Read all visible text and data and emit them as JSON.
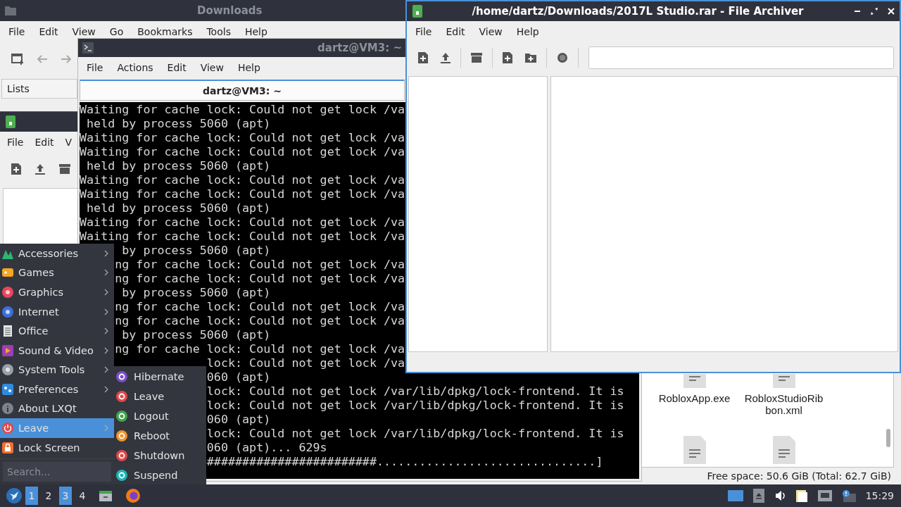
{
  "downloads_window": {
    "title": "Downloads",
    "menu": [
      "File",
      "Edit",
      "View",
      "Go",
      "Bookmarks",
      "Tools",
      "Help"
    ],
    "side_pane": [
      "Lists"
    ],
    "files": [
      {
        "name": "RobloxApp.exe",
        "kind": "top-hidden"
      },
      {
        "name": "RobloxStudioRibbon.xml",
        "kind": "top-hidden"
      },
      {
        "kind": "bottom-hidden"
      },
      {
        "kind": "bottom-hidden"
      }
    ],
    "status": "Free space: 50.6 GiB (Total: 62.7 GiB)"
  },
  "back_archive_window": {
    "menu": [
      "File",
      "Edit",
      "V"
    ]
  },
  "terminal_window": {
    "title": "dartz@VM3: ~",
    "menu": [
      "File",
      "Actions",
      "Edit",
      "View",
      "Help"
    ],
    "tab": "dartz@VM3: ~",
    "lines": [
      {
        "text": "Waiting for cache lock: Could not get lock /va",
        "kind": "full"
      },
      {
        "text": " held by process 5060 (apt)",
        "kind": "full"
      },
      {
        "text": "Waiting for cache lock: Could not get lock /va",
        "kind": "full"
      },
      {
        "text": "Waiting for cache lock: Could not get lock /va",
        "kind": "full"
      },
      {
        "text": " held by process 5060 (apt)",
        "kind": "full"
      },
      {
        "text": "Waiting for cache lock: Could not get lock /va",
        "kind": "full"
      },
      {
        "text": "Waiting for cache lock: Could not get lock /va",
        "kind": "full"
      },
      {
        "text": " held by process 5060 (apt)",
        "kind": "full"
      },
      {
        "text": "Waiting for cache lock: Could not get lock /va",
        "kind": "full"
      },
      {
        "text": "Waiting for cache lock: Could not get lock /va",
        "kind": "full"
      },
      {
        "text": " by process 5060 (apt)",
        "kind": "under-menu"
      },
      {
        "text": "ng for cache lock: Could not get lock /va",
        "kind": "under-menu"
      },
      {
        "text": "ng for cache lock: Could not get lock /va",
        "kind": "under-menu"
      },
      {
        "text": " by process 5060 (apt)",
        "kind": "under-menu"
      },
      {
        "text": "ng for cache lock: Could not get lock /va",
        "kind": "under-menu"
      },
      {
        "text": "ng for cache lock: Could not get lock /va",
        "kind": "under-menu"
      },
      {
        "text": " by process 5060 (apt)",
        "kind": "under-menu"
      },
      {
        "text": "ng for cache lock: Could not get lock /va",
        "kind": "under-menu"
      },
      {
        "text": "lock: Could not get lock /va",
        "kind": "under-submenu"
      },
      {
        "text": "060 (apt)",
        "kind": "under-submenu"
      },
      {
        "text": "lock: Could not get lock /var/lib/dpkg/lock-frontend. It is",
        "kind": "under-submenu"
      },
      {
        "text": "lock: Could not get lock /var/lib/dpkg/lock-frontend. It is",
        "kind": "under-submenu"
      },
      {
        "text": "060 (apt)",
        "kind": "under-submenu"
      },
      {
        "text": "lock: Could not get lock /var/lib/dpkg/lock-frontend. It is",
        "kind": "under-submenu"
      },
      {
        "text": "060 (apt)... 629s",
        "kind": "under-submenu"
      },
      {
        "text": "########################...............................]",
        "kind": "under-submenu"
      }
    ]
  },
  "archive_window": {
    "title": "/home/dartz/Downloads/2017L Studio.rar - File Archiver",
    "menu": [
      "File",
      "Edit",
      "View",
      "Help"
    ]
  },
  "start_menu": {
    "items": [
      {
        "label": "Accessories",
        "kind": "accessories",
        "submenu": true,
        "selected": false
      },
      {
        "label": "Games",
        "kind": "games",
        "submenu": true,
        "selected": false
      },
      {
        "label": "Graphics",
        "kind": "graphics",
        "submenu": true,
        "selected": false
      },
      {
        "label": "Internet",
        "kind": "internet",
        "submenu": true,
        "selected": false
      },
      {
        "label": "Office",
        "kind": "office",
        "submenu": true,
        "selected": false
      },
      {
        "label": "Sound & Video",
        "kind": "multimedia",
        "submenu": true,
        "selected": false
      },
      {
        "label": "System Tools",
        "kind": "system",
        "submenu": true,
        "selected": false
      },
      {
        "label": "Preferences",
        "kind": "preferences",
        "submenu": true,
        "selected": false
      },
      {
        "label": "About LXQt",
        "kind": "about",
        "submenu": false,
        "selected": false
      },
      {
        "label": "Leave",
        "kind": "leave",
        "submenu": true,
        "selected": true
      },
      {
        "label": "Lock Screen",
        "kind": "lock",
        "submenu": false,
        "selected": false
      }
    ],
    "search": {
      "placeholder": "Search..."
    }
  },
  "leave_submenu": {
    "items": [
      {
        "label": "Hibernate",
        "color": "#7a4fc4"
      },
      {
        "label": "Leave",
        "color": "#e04848"
      },
      {
        "label": "Logout",
        "color": "#3fa54a"
      },
      {
        "label": "Reboot",
        "color": "#f0922a"
      },
      {
        "label": "Shutdown",
        "color": "#e04848"
      },
      {
        "label": "Suspend",
        "color": "#1fb5b5"
      }
    ]
  },
  "taskbar": {
    "workspaces": [
      {
        "label": "1",
        "selected": true
      },
      {
        "label": "2",
        "selected": false
      },
      {
        "label": "3",
        "selected": true
      },
      {
        "label": "4",
        "selected": false
      }
    ],
    "clock": "15:29"
  }
}
